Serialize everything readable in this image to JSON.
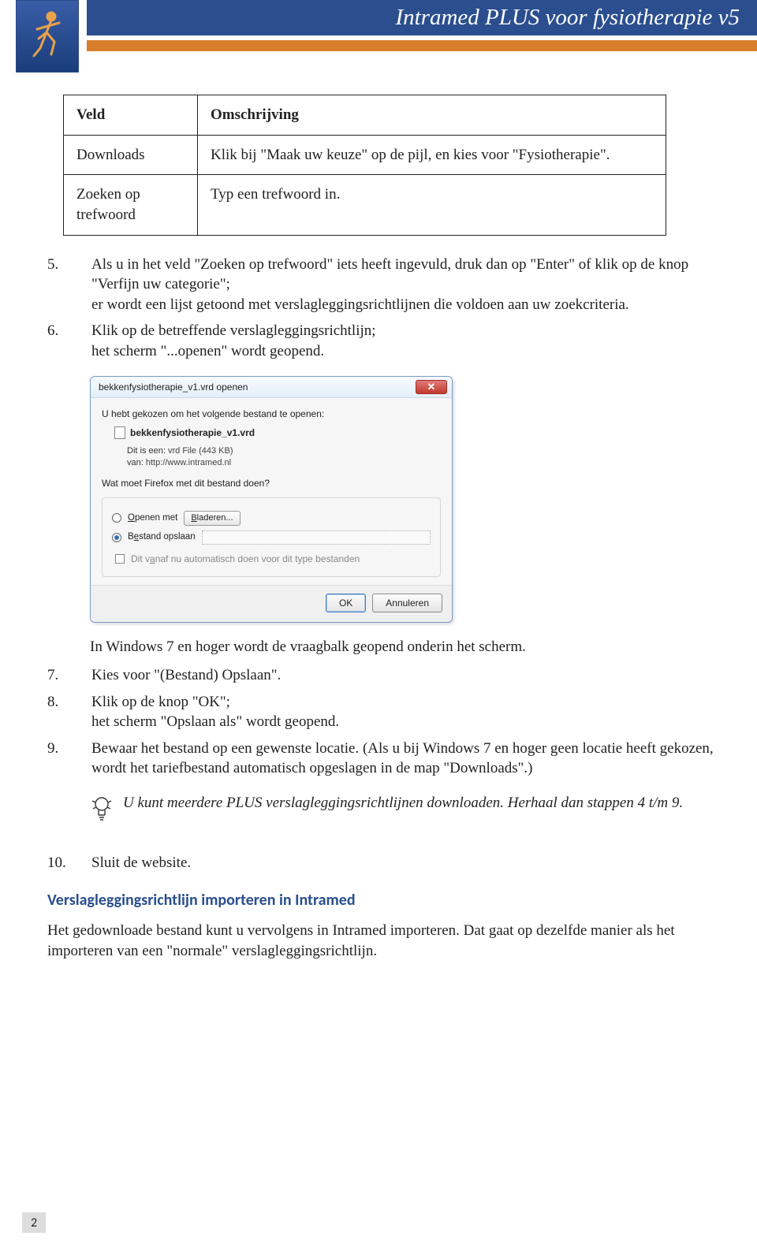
{
  "header": {
    "title": "Intramed PLUS voor fysiotherapie v5"
  },
  "table": {
    "col_field": "Veld",
    "col_desc": "Omschrijving",
    "rows": [
      {
        "field": "Downloads",
        "desc": "Klik bij \"Maak uw keuze\" op de pijl, en kies voor \"Fysiotherapie\"."
      },
      {
        "field": "Zoeken op trefwoord",
        "desc": "Typ een trefwoord in."
      }
    ]
  },
  "steps_a": [
    {
      "n": "5.",
      "text": "Als u in het veld \"Zoeken op trefwoord\" iets heeft ingevuld, druk dan op \"Enter\" of klik op de knop \"Verfijn uw categorie\";",
      "text2": "er wordt een lijst getoond met verslagleggingsrichtlijnen die voldoen aan uw zoekcriteria."
    },
    {
      "n": "6.",
      "text": "Klik op de betreffende verslagleggingsrichtlijn;",
      "text2": "het scherm \"...openen\" wordt geopend."
    }
  ],
  "dialog": {
    "title": "bekkenfysiotherapie_v1.vrd openen",
    "intro": "U hebt gekozen om het volgende bestand te openen:",
    "filename": "bekkenfysiotherapie_v1.vrd",
    "meta_type_label": "Dit is een:",
    "meta_type_value": "vrd File (443 KB)",
    "meta_from_label": "van:",
    "meta_from_value": "http://www.intramed.nl",
    "question": "Wat moet Firefox met dit bestand doen?",
    "opt_open": "Openen met",
    "browse": "Bladeren...",
    "opt_save": "Bestand opslaan",
    "remember": "Dit vanaf nu automatisch doen voor dit type bestanden",
    "ok": "OK",
    "cancel": "Annuleren"
  },
  "after_dialog": "In Windows 7 en hoger wordt de vraagbalk geopend onderin het scherm.",
  "steps_b": [
    {
      "n": "7.",
      "text": "Kies voor \"(Bestand) Opslaan\"."
    },
    {
      "n": "8.",
      "text": "Klik op de knop \"OK\";",
      "text2": "het scherm \"Opslaan als\" wordt geopend."
    },
    {
      "n": "9.",
      "text": "Bewaar het bestand op een gewenste locatie. (Als u bij Windows 7 en hoger geen locatie heeft gekozen, wordt het tariefbestand automatisch opgeslagen in de map \"Downloads\".)"
    }
  ],
  "tip": "U kunt meerdere PLUS verslagleggingsrichtlijnen downloaden. Herhaal dan stappen 4 t/m 9.",
  "steps_c": [
    {
      "n": "10.",
      "text": "Sluit de website."
    }
  ],
  "subheading": "Verslagleggingsrichtlijn importeren in Intramed",
  "paragraph": "Het gedownloade bestand kunt u vervolgens in Intramed importeren. Dat gaat op dezelfde manier als het importeren van een \"normale\" verslagleggingsrichtlijn.",
  "page_number": "2"
}
